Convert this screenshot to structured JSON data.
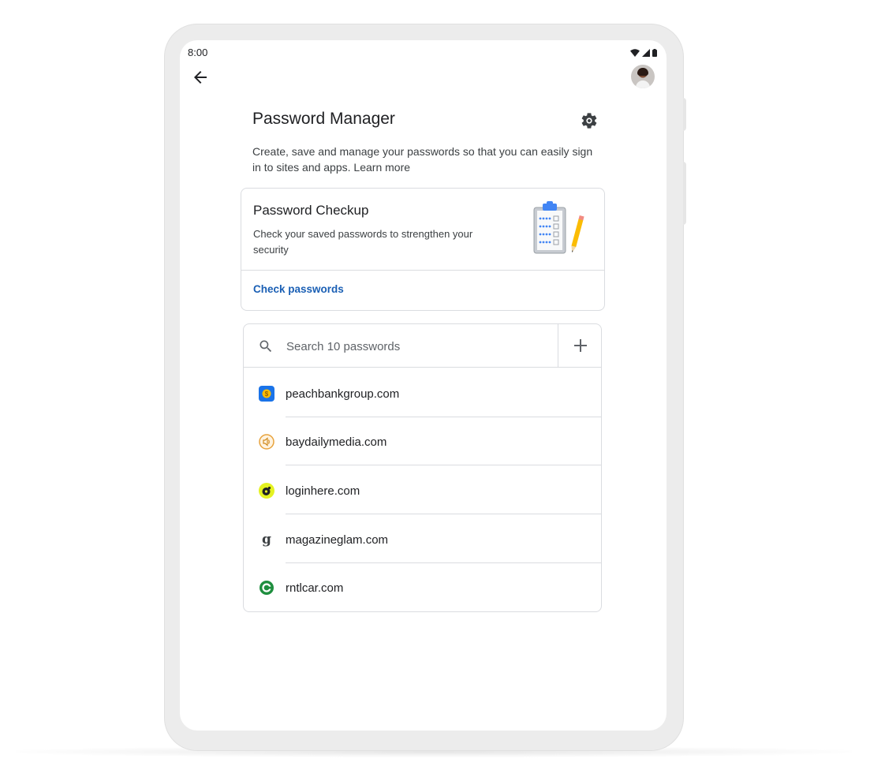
{
  "status_bar": {
    "time": "8:00"
  },
  "header": {
    "title": "Password Manager"
  },
  "intro": {
    "text": "Create, save and manage your passwords so that you can easily sign in to sites and apps.",
    "learn_more": "Learn more"
  },
  "checkup": {
    "title": "Password Checkup",
    "description": "Check your saved passwords to strengthen your security",
    "action": "Check passwords"
  },
  "search": {
    "placeholder": "Search 10 passwords"
  },
  "passwords": [
    {
      "site": "peachbankgroup.com",
      "icon": "bank-dollar-icon"
    },
    {
      "site": "baydailymedia.com",
      "icon": "speaker-icon"
    },
    {
      "site": "loginhere.com",
      "icon": "record-disc-icon"
    },
    {
      "site": "magazineglam.com",
      "icon": "serif-g-icon"
    },
    {
      "site": "rntlcar.com",
      "icon": "green-c-icon"
    }
  ],
  "colors": {
    "link": "#1a5fb4",
    "divider": "#dadce0",
    "frame": "#ececec"
  }
}
